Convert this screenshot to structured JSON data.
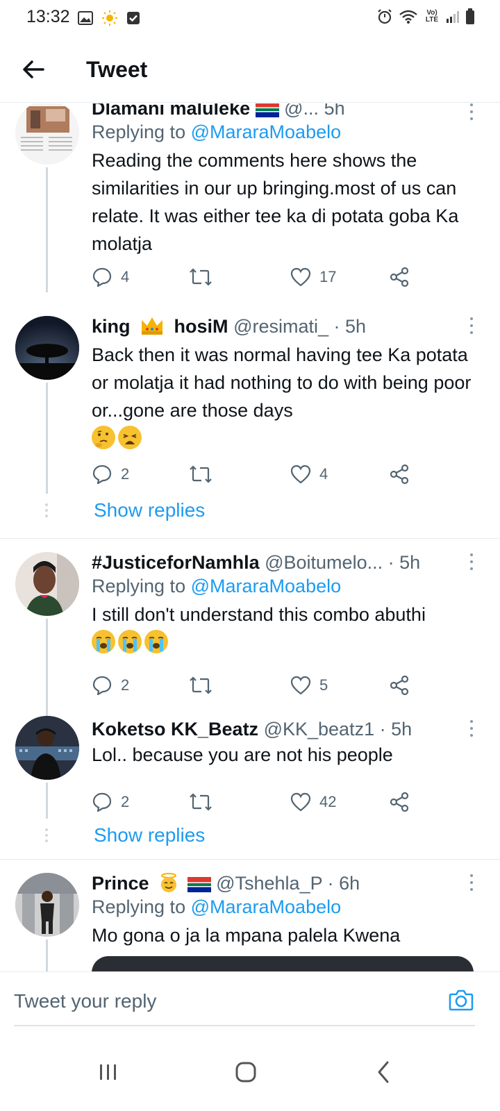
{
  "status_bar": {
    "time": "13:32",
    "network": "Vo) LTE"
  },
  "header": {
    "title": "Tweet"
  },
  "tweets": [
    {
      "name": "Dlamani maluleke",
      "handle": "@...",
      "time": "5h",
      "replying_prefix": "Replying to",
      "replying_to": "@MararaMoabelo",
      "text": "Reading the comments here shows the similarities in our up bringing.most of us can relate. It was either tee ka di potata goba Ka molatja",
      "replies": "4",
      "likes": "17"
    },
    {
      "name_part1": "king",
      "name_part2": "hosiM",
      "handle": "@resimati_",
      "time": "· 5h",
      "text": "Back then it was normal having tee Ka potata or molatja it had nothing to do with being poor or...gone are those days",
      "replies": "2",
      "likes": "4",
      "show_replies": "Show replies"
    },
    {
      "name": "#JusticeforNamhla",
      "handle": "@Boitumelo...",
      "time": "· 5h",
      "replying_prefix": "Replying to",
      "replying_to": "@MararaMoabelo",
      "text": "I still don't understand this combo abuthi",
      "replies": "2",
      "likes": "5"
    },
    {
      "name": "Koketso KK_Beatz",
      "handle": "@KK_beatz1",
      "time": "· 5h",
      "text": "Lol.. because you are not his people",
      "replies": "2",
      "likes": "42",
      "show_replies": "Show replies"
    },
    {
      "name": "Prince",
      "handle": "@Tshehla_P",
      "time": "· 6h",
      "replying_prefix": "Replying to",
      "replying_to": "@MararaMoabelo",
      "text": "Mo gona o ja la mpana palela Kwena"
    }
  ],
  "composer": {
    "placeholder": "Tweet your reply"
  },
  "colors": {
    "accent": "#1d9bf0",
    "secondary_text": "#536471",
    "divider": "#e6ecf0"
  }
}
